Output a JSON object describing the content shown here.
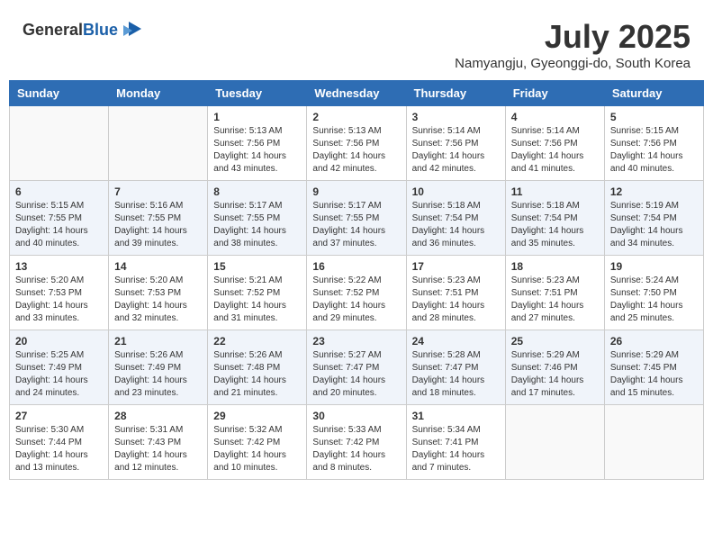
{
  "header": {
    "logo_general": "General",
    "logo_blue": "Blue",
    "month_year": "July 2025",
    "location": "Namyangju, Gyeonggi-do, South Korea"
  },
  "weekdays": [
    "Sunday",
    "Monday",
    "Tuesday",
    "Wednesday",
    "Thursday",
    "Friday",
    "Saturday"
  ],
  "weeks": [
    [
      {
        "day": null
      },
      {
        "day": null
      },
      {
        "day": "1",
        "sunrise": "Sunrise: 5:13 AM",
        "sunset": "Sunset: 7:56 PM",
        "daylight": "Daylight: 14 hours and 43 minutes."
      },
      {
        "day": "2",
        "sunrise": "Sunrise: 5:13 AM",
        "sunset": "Sunset: 7:56 PM",
        "daylight": "Daylight: 14 hours and 42 minutes."
      },
      {
        "day": "3",
        "sunrise": "Sunrise: 5:14 AM",
        "sunset": "Sunset: 7:56 PM",
        "daylight": "Daylight: 14 hours and 42 minutes."
      },
      {
        "day": "4",
        "sunrise": "Sunrise: 5:14 AM",
        "sunset": "Sunset: 7:56 PM",
        "daylight": "Daylight: 14 hours and 41 minutes."
      },
      {
        "day": "5",
        "sunrise": "Sunrise: 5:15 AM",
        "sunset": "Sunset: 7:56 PM",
        "daylight": "Daylight: 14 hours and 40 minutes."
      }
    ],
    [
      {
        "day": "6",
        "sunrise": "Sunrise: 5:15 AM",
        "sunset": "Sunset: 7:55 PM",
        "daylight": "Daylight: 14 hours and 40 minutes."
      },
      {
        "day": "7",
        "sunrise": "Sunrise: 5:16 AM",
        "sunset": "Sunset: 7:55 PM",
        "daylight": "Daylight: 14 hours and 39 minutes."
      },
      {
        "day": "8",
        "sunrise": "Sunrise: 5:17 AM",
        "sunset": "Sunset: 7:55 PM",
        "daylight": "Daylight: 14 hours and 38 minutes."
      },
      {
        "day": "9",
        "sunrise": "Sunrise: 5:17 AM",
        "sunset": "Sunset: 7:55 PM",
        "daylight": "Daylight: 14 hours and 37 minutes."
      },
      {
        "day": "10",
        "sunrise": "Sunrise: 5:18 AM",
        "sunset": "Sunset: 7:54 PM",
        "daylight": "Daylight: 14 hours and 36 minutes."
      },
      {
        "day": "11",
        "sunrise": "Sunrise: 5:18 AM",
        "sunset": "Sunset: 7:54 PM",
        "daylight": "Daylight: 14 hours and 35 minutes."
      },
      {
        "day": "12",
        "sunrise": "Sunrise: 5:19 AM",
        "sunset": "Sunset: 7:54 PM",
        "daylight": "Daylight: 14 hours and 34 minutes."
      }
    ],
    [
      {
        "day": "13",
        "sunrise": "Sunrise: 5:20 AM",
        "sunset": "Sunset: 7:53 PM",
        "daylight": "Daylight: 14 hours and 33 minutes."
      },
      {
        "day": "14",
        "sunrise": "Sunrise: 5:20 AM",
        "sunset": "Sunset: 7:53 PM",
        "daylight": "Daylight: 14 hours and 32 minutes."
      },
      {
        "day": "15",
        "sunrise": "Sunrise: 5:21 AM",
        "sunset": "Sunset: 7:52 PM",
        "daylight": "Daylight: 14 hours and 31 minutes."
      },
      {
        "day": "16",
        "sunrise": "Sunrise: 5:22 AM",
        "sunset": "Sunset: 7:52 PM",
        "daylight": "Daylight: 14 hours and 29 minutes."
      },
      {
        "day": "17",
        "sunrise": "Sunrise: 5:23 AM",
        "sunset": "Sunset: 7:51 PM",
        "daylight": "Daylight: 14 hours and 28 minutes."
      },
      {
        "day": "18",
        "sunrise": "Sunrise: 5:23 AM",
        "sunset": "Sunset: 7:51 PM",
        "daylight": "Daylight: 14 hours and 27 minutes."
      },
      {
        "day": "19",
        "sunrise": "Sunrise: 5:24 AM",
        "sunset": "Sunset: 7:50 PM",
        "daylight": "Daylight: 14 hours and 25 minutes."
      }
    ],
    [
      {
        "day": "20",
        "sunrise": "Sunrise: 5:25 AM",
        "sunset": "Sunset: 7:49 PM",
        "daylight": "Daylight: 14 hours and 24 minutes."
      },
      {
        "day": "21",
        "sunrise": "Sunrise: 5:26 AM",
        "sunset": "Sunset: 7:49 PM",
        "daylight": "Daylight: 14 hours and 23 minutes."
      },
      {
        "day": "22",
        "sunrise": "Sunrise: 5:26 AM",
        "sunset": "Sunset: 7:48 PM",
        "daylight": "Daylight: 14 hours and 21 minutes."
      },
      {
        "day": "23",
        "sunrise": "Sunrise: 5:27 AM",
        "sunset": "Sunset: 7:47 PM",
        "daylight": "Daylight: 14 hours and 20 minutes."
      },
      {
        "day": "24",
        "sunrise": "Sunrise: 5:28 AM",
        "sunset": "Sunset: 7:47 PM",
        "daylight": "Daylight: 14 hours and 18 minutes."
      },
      {
        "day": "25",
        "sunrise": "Sunrise: 5:29 AM",
        "sunset": "Sunset: 7:46 PM",
        "daylight": "Daylight: 14 hours and 17 minutes."
      },
      {
        "day": "26",
        "sunrise": "Sunrise: 5:29 AM",
        "sunset": "Sunset: 7:45 PM",
        "daylight": "Daylight: 14 hours and 15 minutes."
      }
    ],
    [
      {
        "day": "27",
        "sunrise": "Sunrise: 5:30 AM",
        "sunset": "Sunset: 7:44 PM",
        "daylight": "Daylight: 14 hours and 13 minutes."
      },
      {
        "day": "28",
        "sunrise": "Sunrise: 5:31 AM",
        "sunset": "Sunset: 7:43 PM",
        "daylight": "Daylight: 14 hours and 12 minutes."
      },
      {
        "day": "29",
        "sunrise": "Sunrise: 5:32 AM",
        "sunset": "Sunset: 7:42 PM",
        "daylight": "Daylight: 14 hours and 10 minutes."
      },
      {
        "day": "30",
        "sunrise": "Sunrise: 5:33 AM",
        "sunset": "Sunset: 7:42 PM",
        "daylight": "Daylight: 14 hours and 8 minutes."
      },
      {
        "day": "31",
        "sunrise": "Sunrise: 5:34 AM",
        "sunset": "Sunset: 7:41 PM",
        "daylight": "Daylight: 14 hours and 7 minutes."
      },
      {
        "day": null
      },
      {
        "day": null
      }
    ]
  ]
}
